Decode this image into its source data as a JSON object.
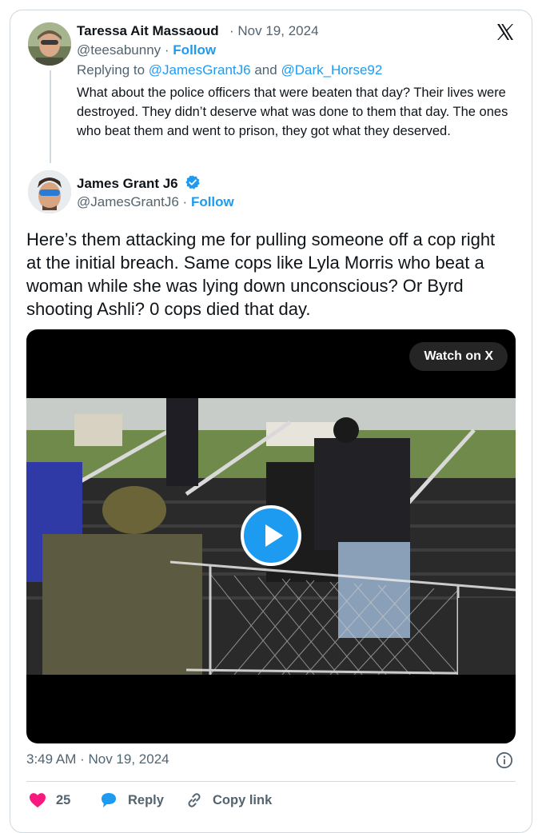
{
  "reply": {
    "author_name": "Taressa Ait Massaoud",
    "date": "Nov 19, 2024",
    "handle": "@teesabunny",
    "follow": "Follow",
    "replying_prefix": "Replying to",
    "replying_user1": "@JamesGrantJ6",
    "replying_and": "and",
    "replying_user2": "@Dark_Horse92",
    "body": "What about the police officers that were beaten that day? Their lives were destroyed. They didn’t deserve what was done to them that day. The ones who beat them and went to prison, they got what they deserved."
  },
  "main": {
    "author_name": "James Grant J6",
    "handle": "@JamesGrantJ6",
    "follow": "Follow",
    "text": "Here’s them attacking me for pulling someone off a cop right at the initial breach. Same cops like Lyla Morris who beat a woman while she was lying down unconscious? Or Byrd shooting Ashli? 0 cops died that day.",
    "watch_label": "Watch on X",
    "timestamp": "3:49 AM · Nov 19, 2024"
  },
  "actions": {
    "likes_count": "25",
    "reply_label": "Reply",
    "copy_link_label": "Copy link"
  },
  "colors": {
    "accent": "#1d9bf0",
    "secondary_text": "#536471",
    "like": "#f91880",
    "border": "#cfd9de"
  }
}
